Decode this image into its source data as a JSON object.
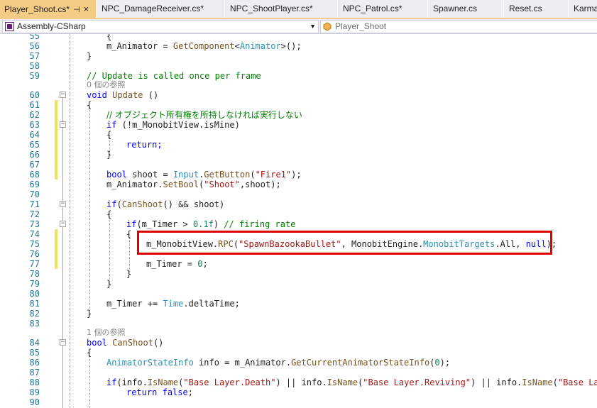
{
  "tabs": [
    {
      "label": "Player_Shoot.cs*",
      "active": true
    },
    {
      "label": "NPC_DamageReceiver.cs*",
      "active": false
    },
    {
      "label": "NPC_ShootPlayer.cs*",
      "active": false
    },
    {
      "label": "NPC_Patrol.cs*",
      "active": false
    },
    {
      "label": "Spawner.cs",
      "active": false
    },
    {
      "label": "Reset.cs",
      "active": false
    },
    {
      "label": "Karma",
      "active": false
    }
  ],
  "tab_pin_icon": "pin-icon",
  "tab_close_icon": "close-icon",
  "nav": {
    "project": "Assembly-CSharp",
    "type": "Player_Shoot"
  },
  "code_lines": [
    {
      "n": "55",
      "text": "        {"
    },
    {
      "n": "56",
      "text": "m_Animator = GetComponent<Animator>();"
    },
    {
      "n": "57",
      "text": "}"
    },
    {
      "n": "58",
      "text": ""
    },
    {
      "n": "59",
      "text": "// Update is called once per frame"
    },
    {
      "n": "60",
      "text": "void Update ()"
    },
    {
      "n": "61",
      "text": "{"
    },
    {
      "n": "62",
      "text": "// オブジェクト所有権を所持しなければ実行しない"
    },
    {
      "n": "63",
      "text": "if (!m_MonobitView.isMine)"
    },
    {
      "n": "64",
      "text": "{"
    },
    {
      "n": "65",
      "text": "return;"
    },
    {
      "n": "66",
      "text": "}"
    },
    {
      "n": "67",
      "text": ""
    },
    {
      "n": "68",
      "text": "bool shoot = Input.GetButton(\"Fire1\");"
    },
    {
      "n": "69",
      "text": "m_Animator.SetBool(\"Shoot\",shoot);"
    },
    {
      "n": "70",
      "text": ""
    },
    {
      "n": "71",
      "text": "if(CanShoot() && shoot)"
    },
    {
      "n": "72",
      "text": "{"
    },
    {
      "n": "73",
      "text": "if(m_Timer > 0.1f) // firing rate"
    },
    {
      "n": "74",
      "text": "{"
    },
    {
      "n": "75",
      "text": "m_MonobitView.RPC(\"SpawnBazookaBullet\", MonobitEngine.MonobitTargets.All, null);"
    },
    {
      "n": "76",
      "text": ""
    },
    {
      "n": "77",
      "text": "m_Timer = 0;"
    },
    {
      "n": "78",
      "text": "}"
    },
    {
      "n": "79",
      "text": "}"
    },
    {
      "n": "80",
      "text": ""
    },
    {
      "n": "81",
      "text": "m_Timer += Time.deltaTime;"
    },
    {
      "n": "82",
      "text": "}"
    },
    {
      "n": "83",
      "text": ""
    },
    {
      "n": "84",
      "text": "bool CanShoot()"
    },
    {
      "n": "85",
      "text": "{"
    },
    {
      "n": "86",
      "text": "AnimatorStateInfo info = m_Animator.GetCurrentAnimatorStateInfo(0);"
    },
    {
      "n": "87",
      "text": ""
    },
    {
      "n": "88",
      "text": "if(info.IsName(\"Base Layer.Death\") || info.IsName(\"Base Layer.Reviving\") || info.IsName(\"Base Layer"
    },
    {
      "n": "89",
      "text": "return false;"
    },
    {
      "n": "90",
      "text": ""
    }
  ],
  "reference_hints": {
    "update": "0 個の参照",
    "canshoot": "1 個の参照"
  },
  "colors": {
    "keyword": "#0000ff",
    "type": "#2b91af",
    "comment": "#008000",
    "string": "#a31515",
    "line_number": "#237893",
    "active_tab": "#f5cc84",
    "highlight_box": "#e00000",
    "change_marker": "#efe25e"
  }
}
